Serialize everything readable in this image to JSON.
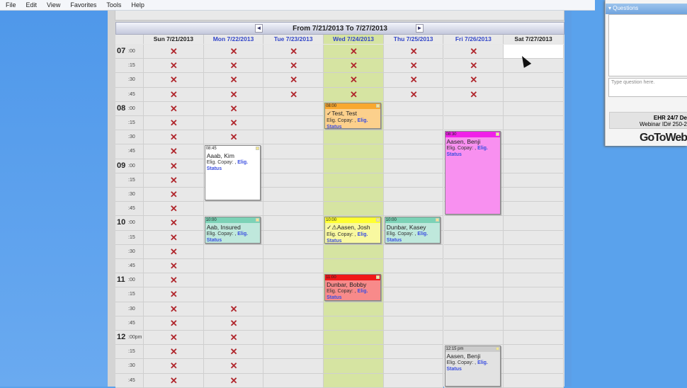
{
  "menu": [
    "File",
    "Edit",
    "View",
    "Favorites",
    "Tools",
    "Help"
  ],
  "calendar": {
    "range_title": "From 7/21/2013 To 7/27/2013",
    "prev_icon": "◄",
    "next_icon": "►",
    "days": [
      "Sun 7/21/2013",
      "Mon 7/22/2013",
      "Tue 7/23/2013",
      "Wed 7/24/2013",
      "Thu 7/25/2013",
      "Fri 7/26/2013",
      "Sat 7/27/2013"
    ],
    "highlight_day": 3,
    "highlight_color": "#d6e4a2",
    "times": [
      {
        "h": "07",
        "m": ":00"
      },
      {
        "m": ":15"
      },
      {
        "m": ":30"
      },
      {
        "m": ":45"
      },
      {
        "h": "08",
        "m": ":00"
      },
      {
        "m": ":15"
      },
      {
        "m": ":30"
      },
      {
        "m": ":45"
      },
      {
        "h": "09",
        "m": ":00"
      },
      {
        "m": ":15"
      },
      {
        "m": ":30"
      },
      {
        "m": ":45"
      },
      {
        "h": "10",
        "m": ":00"
      },
      {
        "m": ":15"
      },
      {
        "m": ":30"
      },
      {
        "m": ":45"
      },
      {
        "h": "11",
        "m": ":00"
      },
      {
        "m": ":15"
      },
      {
        "m": ":30"
      },
      {
        "m": ":45"
      },
      {
        "h": "12",
        "m": ":00pm"
      },
      {
        "m": ":15"
      },
      {
        "m": ":30"
      },
      {
        "m": ":45"
      }
    ],
    "unavailable_mark": "✕",
    "unavailable": {
      "0": [
        0,
        1,
        2,
        3,
        4,
        5,
        6,
        7,
        8,
        9,
        10,
        11,
        12,
        13,
        14,
        15,
        16,
        17,
        18,
        19,
        20,
        21,
        22,
        23
      ],
      "1": [
        0,
        1,
        2,
        3,
        4,
        5,
        6,
        18,
        19,
        20,
        21,
        22,
        23
      ],
      "2": [
        0,
        1,
        2,
        3
      ],
      "3": [
        0,
        1,
        2,
        3
      ],
      "4": [
        0,
        1,
        2,
        3
      ],
      "5": [
        0,
        1,
        2,
        3
      ]
    },
    "appointments": [
      {
        "day": 1,
        "slot": 7,
        "slots": 4,
        "time": "08:45",
        "name": "Aaab, Kim",
        "header_color": "#ffffff",
        "body_color": "#ffffff"
      },
      {
        "day": 1,
        "slot": 12,
        "slots": 2,
        "time": "10:00",
        "name": "Aab, Insured",
        "header_color": "#7cd2b6",
        "body_color": "#bfe8dc"
      },
      {
        "day": 3,
        "slot": 4,
        "slots": 2,
        "time": "08:00",
        "name": "✓Test, Test",
        "header_color": "#f8a830",
        "body_color": "#fcd08c"
      },
      {
        "day": 3,
        "slot": 12,
        "slots": 2,
        "time": "10:00",
        "name": "✓⚠Aasen, Josh",
        "header_color": "#ffff30",
        "body_color": "#f8f8a0"
      },
      {
        "day": 3,
        "slot": 16,
        "slots": 2,
        "time": "11:00",
        "name": "Dunbar, Bobby",
        "header_color": "#f01818",
        "body_color": "#f88a8a"
      },
      {
        "day": 4,
        "slot": 12,
        "slots": 2,
        "time": "10:00",
        "name": "Dunbar, Kasey",
        "header_color": "#7cd2b6",
        "body_color": "#bfe8dc"
      },
      {
        "day": 5,
        "slot": 6,
        "slots": 6,
        "time": "08:30",
        "name": "Aasen, Benji",
        "header_color": "#f020e8",
        "body_color": "#f890f0"
      },
      {
        "day": 5,
        "slot": 21,
        "slots": 3,
        "time": "12:15 pm",
        "name": "Aasen, Benji",
        "header_color": "#cccccc",
        "body_color": "#e2e2e2"
      }
    ],
    "elig_copay": "Elig. Copay: , ",
    "elig_link": "Elig.",
    "status_link": "Status"
  },
  "questions": {
    "title": "Questions",
    "placeholder": "Type question here.",
    "info1": "EHR 24/7 De",
    "info2": "Webinar ID# 250-2",
    "logo": "GoToWeb"
  }
}
